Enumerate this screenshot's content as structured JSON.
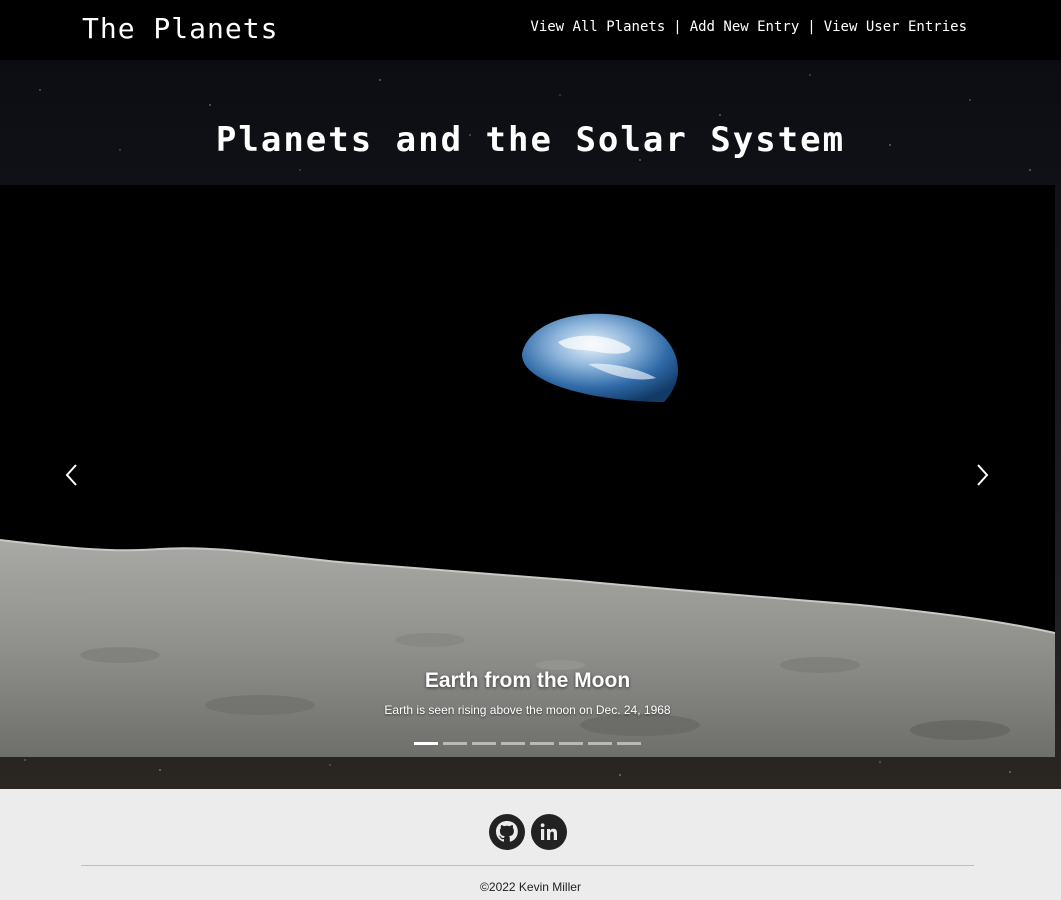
{
  "navbar": {
    "brand": "The Planets",
    "links": [
      {
        "label": "View All Planets"
      },
      {
        "label": "Add New Entry"
      },
      {
        "label": "View User Entries"
      }
    ],
    "separator": "|"
  },
  "hero": {
    "title": "Planets and the Solar System"
  },
  "carousel": {
    "active_slide": {
      "title": "Earth from the Moon",
      "text": "Earth is seen rising above the moon on Dec. 24, 1968"
    },
    "slide_count": 8,
    "active_index": 0,
    "prev_icon": "chevron-left-icon",
    "next_icon": "chevron-right-icon"
  },
  "footer": {
    "social": [
      {
        "name": "github-icon"
      },
      {
        "name": "linkedin-icon"
      }
    ],
    "copyright": "©2022 Kevin Miller"
  }
}
